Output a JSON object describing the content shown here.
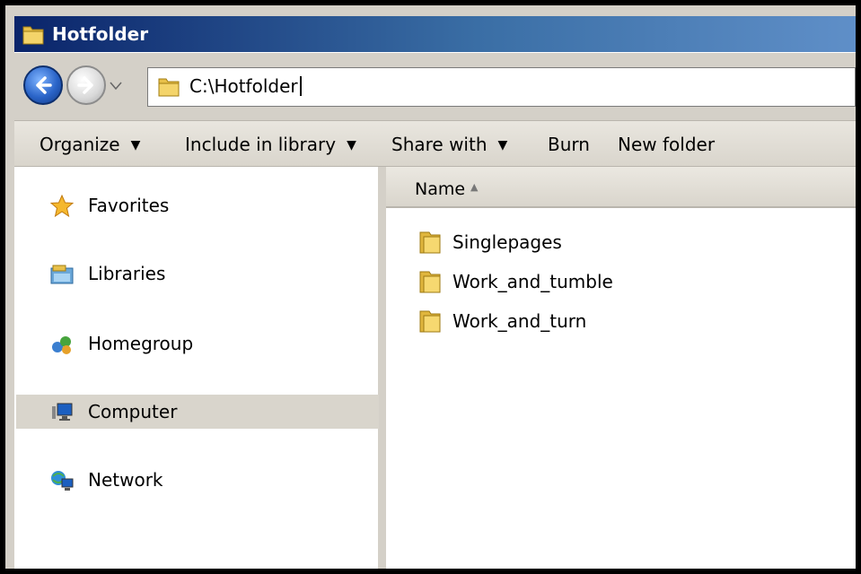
{
  "window": {
    "title": "Hotfolder"
  },
  "address": {
    "path": "C:\\Hotfolder"
  },
  "toolbar": {
    "organize": "Organize",
    "include_in_library": "Include in library",
    "share_with": "Share with",
    "burn": "Burn",
    "new_folder": "New folder"
  },
  "navigation": {
    "items": [
      {
        "label": "Favorites",
        "icon": "star-icon"
      },
      {
        "label": "Libraries",
        "icon": "libraries-icon"
      },
      {
        "label": "Homegroup",
        "icon": "homegroup-icon"
      },
      {
        "label": "Computer",
        "icon": "computer-icon",
        "selected": true
      },
      {
        "label": "Network",
        "icon": "network-icon"
      }
    ]
  },
  "content": {
    "column_header": "Name",
    "sort_indicator": "ascending",
    "files": [
      {
        "name": "Singlepages",
        "icon": "folder-icon"
      },
      {
        "name": "Work_and_tumble",
        "icon": "folder-icon"
      },
      {
        "name": "Work_and_turn",
        "icon": "folder-icon"
      }
    ]
  },
  "colors": {
    "titlebar_start": "#0a246a",
    "titlebar_end": "#5f8fc8",
    "selection": "#d9d5cc",
    "folder": "#e8c04a"
  }
}
